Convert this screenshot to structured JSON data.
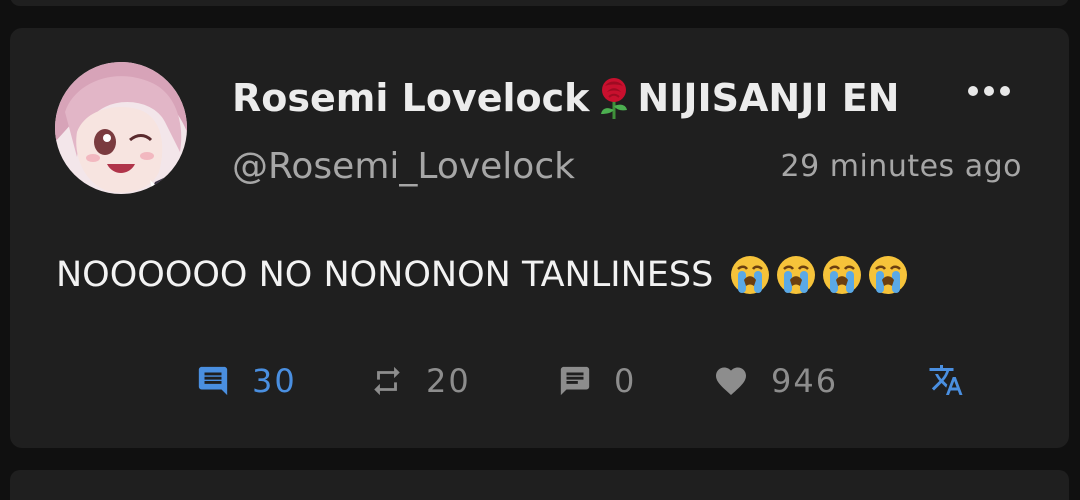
{
  "post": {
    "display_name_part1": "Rosemi Lovelock",
    "display_name_part2": "NIJISANJI EN",
    "handle": "@Rosemi_Lovelock",
    "timestamp": "29 minutes ago",
    "text": "NOOOOOO NO NONONON TANLINESS",
    "emoji_count": 4,
    "emoji_name": "loudly-crying-face",
    "icons": {
      "name_emoji": "rose-icon",
      "menu": "more-options-icon"
    }
  },
  "actions": {
    "replies": {
      "icon": "comment-icon",
      "count": "30",
      "color": "#4a8fe0"
    },
    "retweets": {
      "icon": "retweet-icon",
      "count": "20",
      "color": "#8d8d8d"
    },
    "quotes": {
      "icon": "quote-icon",
      "count": "0",
      "color": "#8d8d8d"
    },
    "likes": {
      "icon": "heart-icon",
      "count": "946",
      "color": "#8d8d8d"
    },
    "translate": {
      "icon": "translate-icon",
      "color": "#4a8fe0"
    }
  }
}
